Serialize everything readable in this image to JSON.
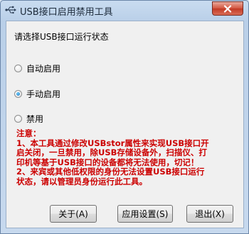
{
  "window": {
    "title": "USB接口启用禁用工具",
    "icon": "usb-icon",
    "close_icon": "close-icon"
  },
  "main": {
    "prompt": "请选择USB接口运行状态",
    "options": [
      {
        "label": "自动启用",
        "checked": false
      },
      {
        "label": "手动启用",
        "checked": true
      },
      {
        "label": "禁用",
        "checked": false
      }
    ],
    "note": {
      "heading": "注意：",
      "lines": [
        "1、本工具通过修改USBstor属性来实现USB接口开",
        "启关闭，一旦禁用，除USB存储设备外，扫描仪、打",
        "印机等基于USB接口的设备都将无法使用，切记！",
        "2、来宾或其他低权限的身份无法设置USB接口运行",
        "状态，请以管理员身份运行此工具。"
      ],
      "color": "#cc0000"
    }
  },
  "buttons": {
    "about": "关于(A)",
    "apply": "应用设置(S)",
    "exit": "退出(X)"
  }
}
